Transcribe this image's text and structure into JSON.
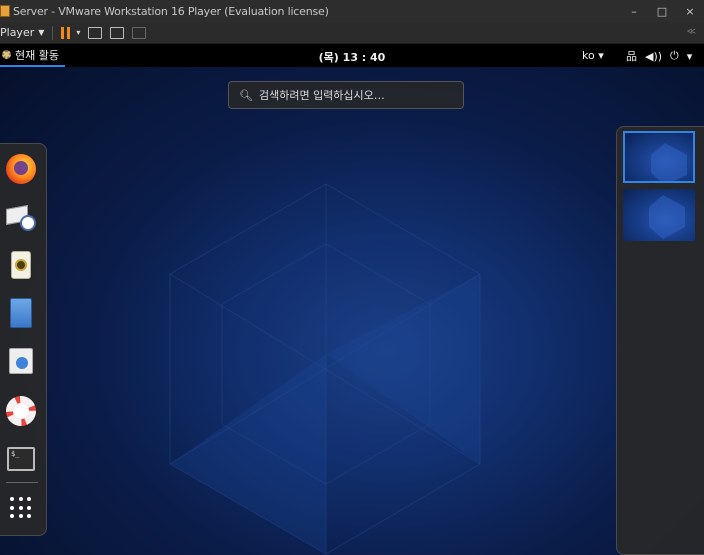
{
  "window": {
    "title": "Server - VMware Workstation 16 Player (Evaluation license)",
    "buttons": {
      "minimize": "–",
      "maximize": "□",
      "close": "×"
    }
  },
  "toolbar": {
    "player_label": "Player",
    "player_caret": "▼",
    "pause_caret": "▾",
    "right_hint": "≪"
  },
  "gnome": {
    "activities": "현재 활동",
    "clock": "(목) 13 : 40",
    "language": "ko ▾",
    "system_icons": {
      "network": "品",
      "volume": "◀))",
      "power": "⏻",
      "caret": "▾"
    }
  },
  "search": {
    "placeholder": "검색하려면 입력하십시오…",
    "icon": "search-icon"
  },
  "dash": {
    "items": [
      {
        "name": "firefox",
        "icon": "firefox-icon"
      },
      {
        "name": "evolution",
        "icon": "mail-clock-icon"
      },
      {
        "name": "rhythmbox",
        "icon": "speaker-icon"
      },
      {
        "name": "files",
        "icon": "file-cabinet-icon"
      },
      {
        "name": "software",
        "icon": "store-bag-icon"
      },
      {
        "name": "help",
        "icon": "lifebuoy-icon"
      },
      {
        "name": "terminal",
        "icon": "terminal-icon",
        "prompt": "$_"
      },
      {
        "name": "show-applications",
        "icon": "app-grid-icon"
      }
    ]
  },
  "workspaces": {
    "count": 2,
    "active_index": 0
  },
  "colors": {
    "accent": "#3584e4",
    "pause": "#f08a1c",
    "topbar": "#000000"
  }
}
